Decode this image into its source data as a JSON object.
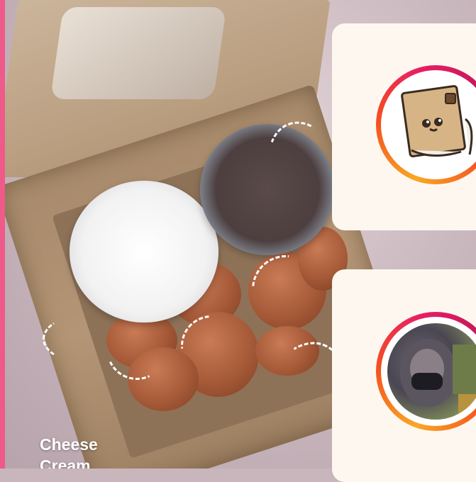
{
  "photo": {
    "caption_lines": [
      "Cheese",
      "Cream"
    ],
    "accent_color": "#ee5a8a"
  },
  "cards": [
    {
      "avatar": "cartoon-box-character",
      "ring_colors": [
        "#f9a825",
        "#e91e63"
      ]
    },
    {
      "avatar": "profile-photo-person",
      "ring_colors": [
        "#f9a825",
        "#e91e63"
      ]
    }
  ]
}
